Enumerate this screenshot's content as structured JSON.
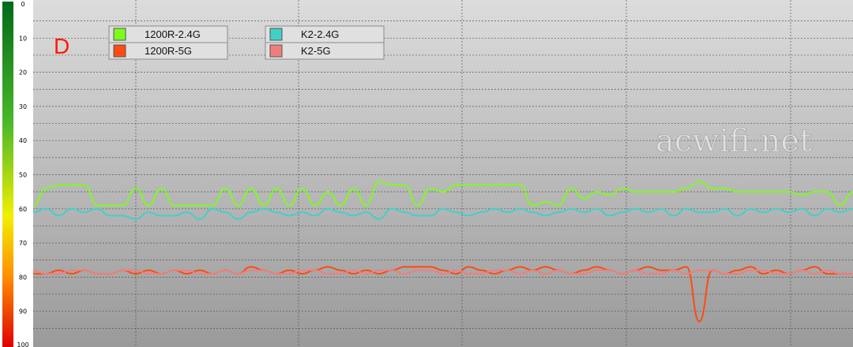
{
  "panel_label": "D",
  "watermark": "acwifi.net",
  "chart_data": {
    "type": "line",
    "title": "",
    "xlabel": "",
    "ylabel": "",
    "ylim": [
      0,
      100
    ],
    "y_inverted": true,
    "y_ticks": [
      0,
      10,
      20,
      30,
      40,
      50,
      60,
      70,
      80,
      90,
      100
    ],
    "grid": true,
    "legend_position": "top-left",
    "series": [
      {
        "name": "1200R-2.4G",
        "color": "#7cfc1c",
        "values": [
          59,
          54,
          53,
          53,
          53,
          59,
          59,
          59,
          54,
          59,
          54,
          59,
          59,
          59,
          59,
          54,
          59,
          54,
          59,
          54,
          59,
          54,
          59,
          55,
          59,
          54,
          59,
          52,
          53,
          53,
          59,
          54,
          55,
          53,
          53,
          53,
          53,
          53,
          53,
          59,
          58,
          59,
          54,
          57,
          55,
          56,
          54,
          55,
          55,
          55,
          55,
          54,
          52,
          54,
          54,
          55,
          55,
          55,
          55,
          55,
          56,
          55,
          55,
          59,
          55
        ]
      },
      {
        "name": "1200R-5G",
        "color": "#ff4a10",
        "values": [
          79,
          79,
          78,
          79,
          78,
          79,
          79,
          78,
          79,
          78,
          79,
          78,
          79,
          78,
          79,
          78,
          79,
          77,
          78,
          79,
          78,
          79,
          78,
          77,
          78,
          79,
          78,
          79,
          78,
          77,
          77,
          77,
          78,
          79,
          77,
          78,
          79,
          78,
          77,
          78,
          77,
          78,
          79,
          78,
          77,
          78,
          79,
          78,
          77,
          78,
          78,
          77,
          93,
          78,
          79,
          78,
          77,
          79,
          78,
          79,
          78,
          77,
          79,
          79,
          79
        ]
      },
      {
        "name": "K2-2.4G",
        "color": "#40d0c8",
        "values": [
          61,
          60,
          62,
          60,
          61,
          60,
          62,
          62,
          63,
          61,
          62,
          62,
          61,
          63,
          60,
          61,
          63,
          61,
          60,
          61,
          62,
          61,
          62,
          60,
          61,
          62,
          61,
          63,
          60,
          61,
          62,
          62,
          60,
          61,
          62,
          61,
          60,
          61,
          60,
          61,
          62,
          61,
          60,
          61,
          60,
          62,
          61,
          60,
          61,
          60,
          62,
          60,
          61,
          61,
          60,
          62,
          60,
          61,
          60,
          61,
          60,
          62,
          60,
          61,
          60
        ]
      },
      {
        "name": "K2-5G",
        "color": "#f07e7e",
        "values": [
          78,
          79,
          79,
          78,
          78,
          79,
          79,
          78,
          78,
          79,
          79,
          78,
          78,
          79,
          79,
          78,
          79,
          78,
          78,
          79,
          79,
          78,
          78,
          79,
          79,
          78,
          79,
          78,
          78,
          79,
          78,
          78,
          79,
          78,
          79,
          79,
          78,
          78,
          79,
          78,
          79,
          78,
          79,
          79,
          78,
          78,
          79,
          78,
          79,
          79,
          78,
          79,
          78,
          78,
          79,
          79,
          78,
          78,
          79,
          79,
          78,
          79,
          78,
          79,
          79
        ]
      }
    ]
  }
}
